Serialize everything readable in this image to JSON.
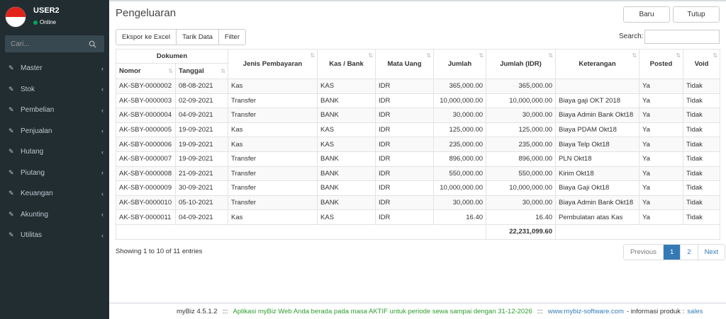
{
  "sidebar": {
    "user_name": "USER2",
    "status": "Online",
    "search_placeholder": "Cari...",
    "menu": [
      {
        "label": "Master"
      },
      {
        "label": "Stok"
      },
      {
        "label": "Pembelian"
      },
      {
        "label": "Penjualan"
      },
      {
        "label": "Hutang"
      },
      {
        "label": "Piutang"
      },
      {
        "label": "Keuangan"
      },
      {
        "label": "Akunting"
      },
      {
        "label": "Utilitas"
      }
    ]
  },
  "page": {
    "title": "Pengeluaran",
    "btn_new": "Baru",
    "btn_close": "Tutup",
    "toolbar": {
      "export": "Ekspor ke Excel",
      "pull": "Tarik Data",
      "filter": "Filter"
    },
    "search_label": "Search:",
    "search_value": ""
  },
  "table": {
    "group_header": "Dokumen",
    "columns": {
      "nomor": "Nomor",
      "tanggal": "Tanggal",
      "jenis": "Jenis Pembayaran",
      "kas": "Kas / Bank",
      "mata_uang": "Mata Uang",
      "jumlah": "Jumlah",
      "jumlah_idr": "Jumlah (IDR)",
      "keterangan": "Keterangan",
      "posted": "Posted",
      "void": "Void"
    },
    "rows": [
      {
        "nomor": "AK-SBY-0000002",
        "tanggal": "08-08-2021",
        "jenis": "Kas",
        "kas": "KAS",
        "mu": "IDR",
        "jumlah": "365,000.00",
        "jumlah_idr": "365,000.00",
        "ket": "",
        "posted": "Ya",
        "void": "Tidak"
      },
      {
        "nomor": "AK-SBY-0000003",
        "tanggal": "02-09-2021",
        "jenis": "Transfer",
        "kas": "BANK",
        "mu": "IDR",
        "jumlah": "10,000,000.00",
        "jumlah_idr": "10,000,000.00",
        "ket": "Biaya gaji OKT 2018",
        "posted": "Ya",
        "void": "Tidak"
      },
      {
        "nomor": "AK-SBY-0000004",
        "tanggal": "04-09-2021",
        "jenis": "Transfer",
        "kas": "BANK",
        "mu": "IDR",
        "jumlah": "30,000.00",
        "jumlah_idr": "30,000.00",
        "ket": "Biaya Admin Bank Okt18",
        "posted": "Ya",
        "void": "Tidak"
      },
      {
        "nomor": "AK-SBY-0000005",
        "tanggal": "19-09-2021",
        "jenis": "Kas",
        "kas": "KAS",
        "mu": "IDR",
        "jumlah": "125,000.00",
        "jumlah_idr": "125,000.00",
        "ket": "Biaya PDAM Okt18",
        "posted": "Ya",
        "void": "Tidak"
      },
      {
        "nomor": "AK-SBY-0000006",
        "tanggal": "19-09-2021",
        "jenis": "Kas",
        "kas": "KAS",
        "mu": "IDR",
        "jumlah": "235,000.00",
        "jumlah_idr": "235,000.00",
        "ket": "Biaya Telp Okt18",
        "posted": "Ya",
        "void": "Tidak"
      },
      {
        "nomor": "AK-SBY-0000007",
        "tanggal": "19-09-2021",
        "jenis": "Transfer",
        "kas": "BANK",
        "mu": "IDR",
        "jumlah": "896,000.00",
        "jumlah_idr": "896,000.00",
        "ket": "PLN Okt18",
        "posted": "Ya",
        "void": "Tidak"
      },
      {
        "nomor": "AK-SBY-0000008",
        "tanggal": "21-09-2021",
        "jenis": "Transfer",
        "kas": "BANK",
        "mu": "IDR",
        "jumlah": "550,000.00",
        "jumlah_idr": "550,000.00",
        "ket": "Kirim Okt18",
        "posted": "Ya",
        "void": "Tidak"
      },
      {
        "nomor": "AK-SBY-0000009",
        "tanggal": "30-09-2021",
        "jenis": "Transfer",
        "kas": "BANK",
        "mu": "IDR",
        "jumlah": "10,000,000.00",
        "jumlah_idr": "10,000,000.00",
        "ket": "Biaya Gaji Okt18",
        "posted": "Ya",
        "void": "Tidak"
      },
      {
        "nomor": "AK-SBY-0000010",
        "tanggal": "05-10-2021",
        "jenis": "Transfer",
        "kas": "BANK",
        "mu": "IDR",
        "jumlah": "30,000.00",
        "jumlah_idr": "30,000.00",
        "ket": "Biaya Admin Bank Okt18",
        "posted": "Ya",
        "void": "Tidak"
      },
      {
        "nomor": "AK-SBY-0000011",
        "tanggal": "04-09-2021",
        "jenis": "Kas",
        "kas": "KAS",
        "mu": "IDR",
        "jumlah": "16.40",
        "jumlah_idr": "16.40",
        "ket": "Pembulatan atas Kas",
        "posted": "Ya",
        "void": "Tidak"
      }
    ],
    "total_idr": "22,231,099.60"
  },
  "pagination": {
    "info": "Showing 1 to 10 of 11 entries",
    "previous": "Previous",
    "pages": [
      "1",
      "2"
    ],
    "next": "Next"
  },
  "footer": {
    "version": "myBiz 4.5.1.2",
    "sep": ":::",
    "notice": "Aplikasi myBiz Web Anda berada pada masa AKTIF untuk periode sewa sampai dengan 31-12-2026",
    "website": "www.mybiz-software.com",
    "info": "- informasi produk :",
    "email": "sales"
  },
  "colors": {
    "sidebar": "#222d32",
    "active_page": "#337ab7",
    "notice": "#2e9e2e"
  }
}
